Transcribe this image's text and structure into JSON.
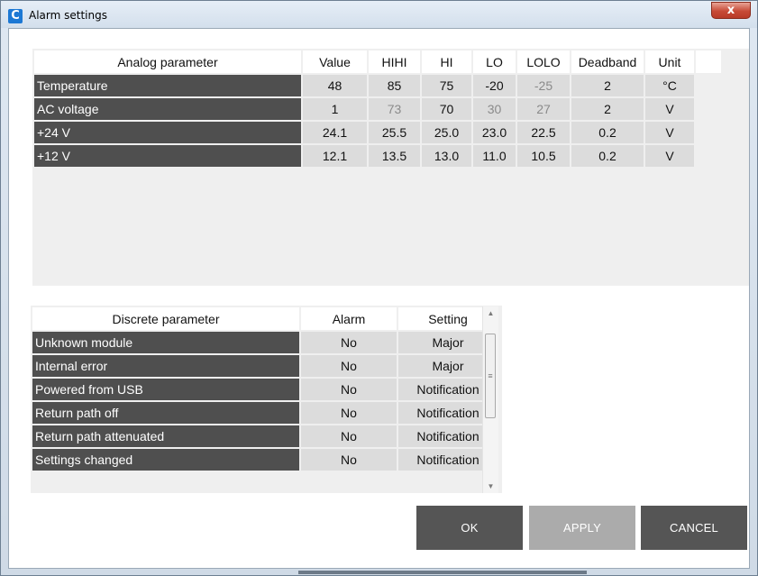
{
  "window": {
    "title": "Alarm settings",
    "icon": "C",
    "close_label": "x"
  },
  "analog": {
    "headers": [
      "Analog parameter",
      "Value",
      "HIHI",
      "HI",
      "LO",
      "LOLO",
      "Deadband",
      "Unit"
    ],
    "rows": [
      {
        "name": "Temperature",
        "value": "48",
        "hihi": "85",
        "hi": "75",
        "lo": "-20",
        "lolo": "-25",
        "deadband": "2",
        "unit": "°C"
      },
      {
        "name": "AC voltage",
        "value": "1",
        "hihi": "73",
        "hi": "70",
        "lo": "30",
        "lolo": "27",
        "deadband": "2",
        "unit": "V"
      },
      {
        "name": "+24 V",
        "value": "24.1",
        "hihi": "25.5",
        "hi": "25.0",
        "lo": "23.0",
        "lolo": "22.5",
        "deadband": "0.2",
        "unit": "V"
      },
      {
        "name": "+12 V",
        "value": "12.1",
        "hihi": "13.5",
        "hi": "13.0",
        "lo": "11.0",
        "lolo": "10.5",
        "deadband": "0.2",
        "unit": "V"
      }
    ]
  },
  "discrete": {
    "headers": [
      "Discrete parameter",
      "Alarm",
      "Setting"
    ],
    "rows": [
      {
        "name": "Unknown module",
        "alarm": "No",
        "setting": "Major"
      },
      {
        "name": "Internal error",
        "alarm": "No",
        "setting": "Major"
      },
      {
        "name": "Powered from USB",
        "alarm": "No",
        "setting": "Notification"
      },
      {
        "name": "Return path off",
        "alarm": "No",
        "setting": "Notification"
      },
      {
        "name": "Return path attenuated",
        "alarm": "No",
        "setting": "Notification"
      },
      {
        "name": "Settings changed",
        "alarm": "No",
        "setting": "Notification"
      }
    ]
  },
  "buttons": {
    "ok": "OK",
    "apply": "APPLY",
    "cancel": "CANCEL"
  },
  "colors": {
    "row_header_bg": "#4f4f4f",
    "cell_bg": "#dcdcdc",
    "button_dark": "#555555",
    "button_disabled": "#ababab",
    "app_icon": "#1c78d4"
  }
}
